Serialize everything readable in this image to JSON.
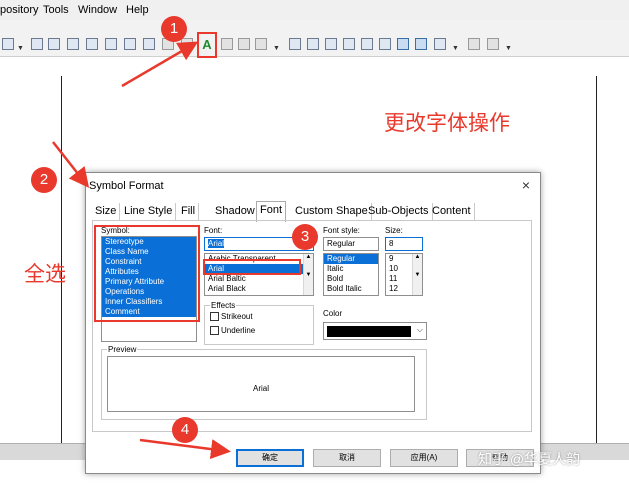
{
  "menubar": {
    "items": [
      "pository",
      "Tools",
      "Window",
      "Help"
    ]
  },
  "toolbar": {
    "font_button_glyph": "A"
  },
  "annotations": {
    "step1": "1",
    "step2": "2",
    "step3": "3",
    "step4": "4",
    "change_font_label": "更改字体操作",
    "select_all_label": "全选",
    "accent_color": "#e8392c"
  },
  "dialog": {
    "title": "Symbol Format",
    "close_icon": "×",
    "tabs": [
      "Size",
      "Line Style",
      "Fill",
      "Shadow",
      "Font",
      "Custom Shape",
      "Sub-Objects",
      "Content"
    ],
    "active_tab": "Font",
    "symbol_label": "Symbol:",
    "symbol_items": [
      "Stereotype",
      "Class Name",
      "Constraint",
      "Attributes",
      "Primary Attribute",
      "Operations",
      "Inner Classifiers",
      "Comment"
    ],
    "font_label": "Font:",
    "font_value": "Arial",
    "font_items": [
      "Arabic Transparent",
      "Arial",
      "Arial Baltic",
      "Arial Black"
    ],
    "font_selected": "Arial",
    "style_label": "Font style:",
    "style_value": "Regular",
    "style_items": [
      "Regular",
      "Italic",
      "Bold",
      "Bold Italic"
    ],
    "size_label": "Size:",
    "size_value": "8",
    "size_items": [
      "9",
      "10",
      "11",
      "12"
    ],
    "effects_label": "Effects",
    "strikeout_label": "Strikeout",
    "underline_label": "Underline",
    "color_label": "Color",
    "color_value": "#000000",
    "preview_label": "Preview",
    "preview_text": "Arial",
    "ok_label": "确定",
    "cancel_label": "取消",
    "apply_label": "应用(A)",
    "help_label": "帮助"
  },
  "watermark": "知乎 @华夏人韵"
}
